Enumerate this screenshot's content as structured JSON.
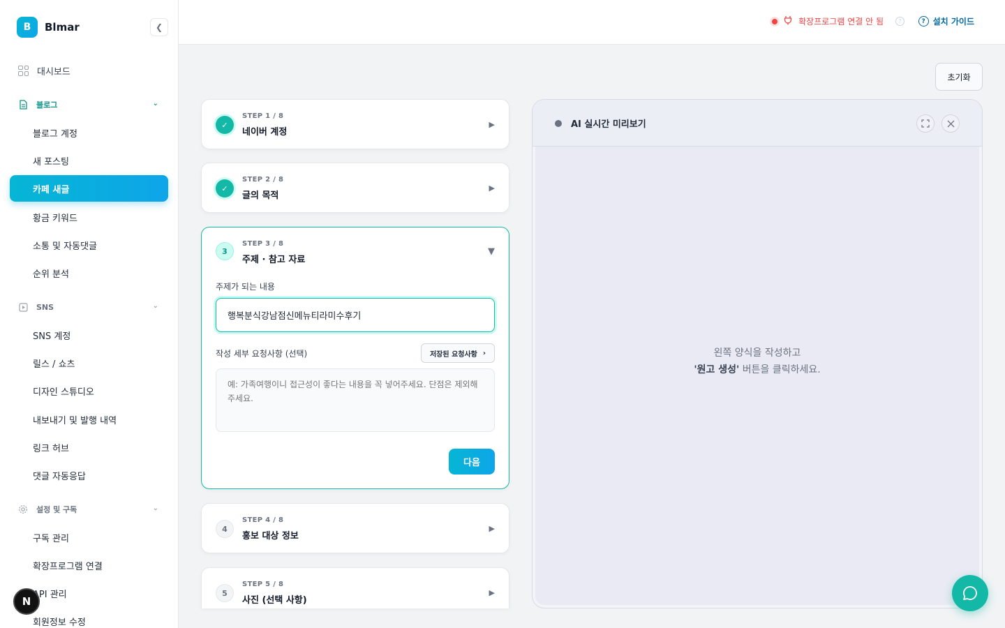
{
  "brand": {
    "logo_letter": "B",
    "name": "Blmar"
  },
  "sidebar": {
    "dashboard": "대시보드",
    "sections": [
      {
        "label": "블로그",
        "items": [
          "블로그 계정",
          "새 포스팅",
          "카페 새글",
          "황금 키워드",
          "소통 및 자동댓글",
          "순위 분석"
        ]
      },
      {
        "label": "SNS",
        "items": [
          "SNS 계정",
          "릴스 / 쇼츠",
          "디자인 스튜디오",
          "내보내기 및 발행 내역",
          "링크 허브",
          "댓글 자동응답"
        ]
      },
      {
        "label": "설정 및 구독",
        "items": [
          "구독 관리",
          "확장프로그램 연결",
          "API 관리",
          "회원정보 수정"
        ]
      }
    ],
    "active_item": "카페 새글",
    "n_badge": "N"
  },
  "topbar": {
    "extension_status": "확장프로그램 연결 안 됨",
    "guide_label": "설치 가이드",
    "status_color": "#ef4444"
  },
  "reset_label": "초기화",
  "steps": [
    {
      "meta": "STEP 1 / 8",
      "title": "네이버 계정",
      "status": "done"
    },
    {
      "meta": "STEP 2 / 8",
      "title": "글의 목적",
      "status": "done"
    },
    {
      "number": "3",
      "meta": "STEP 3 / 8",
      "title": "주제 · 참고 자료",
      "status": "current"
    },
    {
      "number": "4",
      "meta": "STEP 4 / 8",
      "title": "홍보 대상 정보",
      "status": "todo"
    },
    {
      "number": "5",
      "meta": "STEP 5 / 8",
      "title": "사진 (선택 사항)",
      "status": "todo"
    }
  ],
  "step3_form": {
    "topic_label": "주제가 되는 내용",
    "topic_value": "행복분식강남점신메뉴티라미수후기",
    "detail_label": "작성 세부 요청사항 (선택)",
    "saved_requests_label": "저장된 요청사항",
    "detail_placeholder": "예: 가족여행이니 접근성이 좋다는 내용을 꼭 넣어주세요. 단점은 제외해주세요.",
    "next_label": "다음"
  },
  "preview": {
    "title": "AI 실시간 미리보기",
    "hint_line1": "왼쪽 양식을 작성하고",
    "hint_highlight": "'원고 생성'",
    "hint_line2": " 버튼을 클릭하세요."
  },
  "colors": {
    "accent": "#14b8a6",
    "brand_gradient_start": "#06b6d4",
    "brand_gradient_end": "#0ea5e9"
  }
}
